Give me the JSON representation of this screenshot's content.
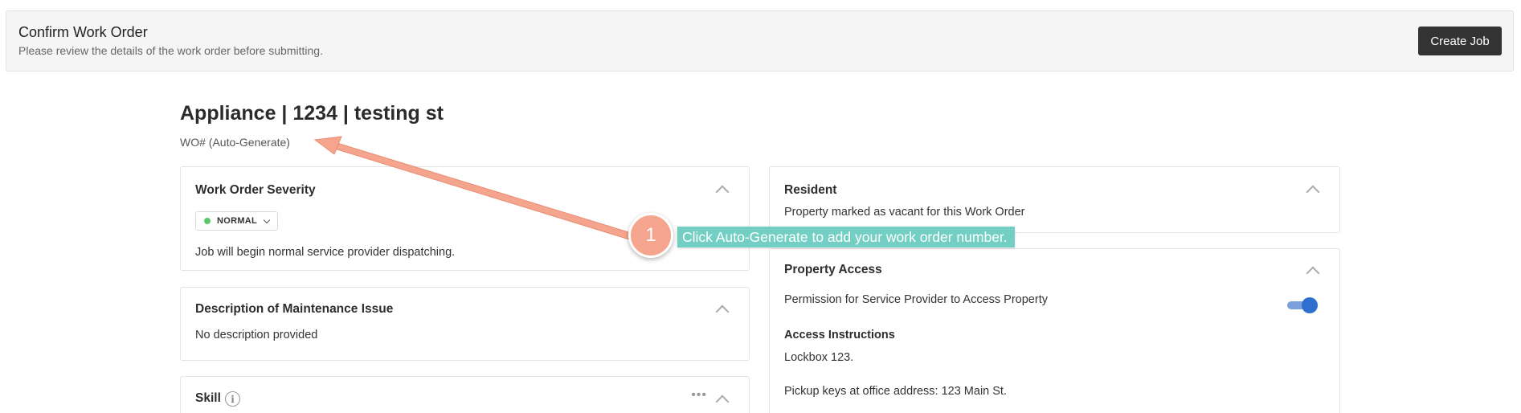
{
  "header": {
    "title": "Confirm Work Order",
    "subtitle": "Please review the details of the work order before submitting.",
    "create_button": "Create Job"
  },
  "work_order": {
    "title": "Appliance | 1234 | testing st",
    "number_link": "WO# (Auto-Generate)"
  },
  "severity_card": {
    "title": "Work Order Severity",
    "severity": "NORMAL",
    "severity_color": "#5cc76a",
    "description": "Job will begin normal service provider dispatching."
  },
  "description_card": {
    "title": "Description of Maintenance Issue",
    "text": "No description provided"
  },
  "skill_card": {
    "title": "Skill",
    "info_icon": "i",
    "more_icon": "•••"
  },
  "resident_card": {
    "title": "Resident",
    "text": "Property marked as vacant for this Work Order"
  },
  "access_card": {
    "title": "Property Access",
    "permission_label": "Permission for Service Provider to Access Property",
    "permission_enabled": true,
    "instructions_title": "Access Instructions",
    "instructions_line1": "Lockbox 123.",
    "instructions_line2": "Pickup keys at office address: 123 Main St."
  },
  "tutorial": {
    "step_number": "1",
    "tip_text": "Click Auto-Generate to add your work order number.",
    "accent_color": "#f5a58d",
    "tip_color": "#73cfc4"
  }
}
